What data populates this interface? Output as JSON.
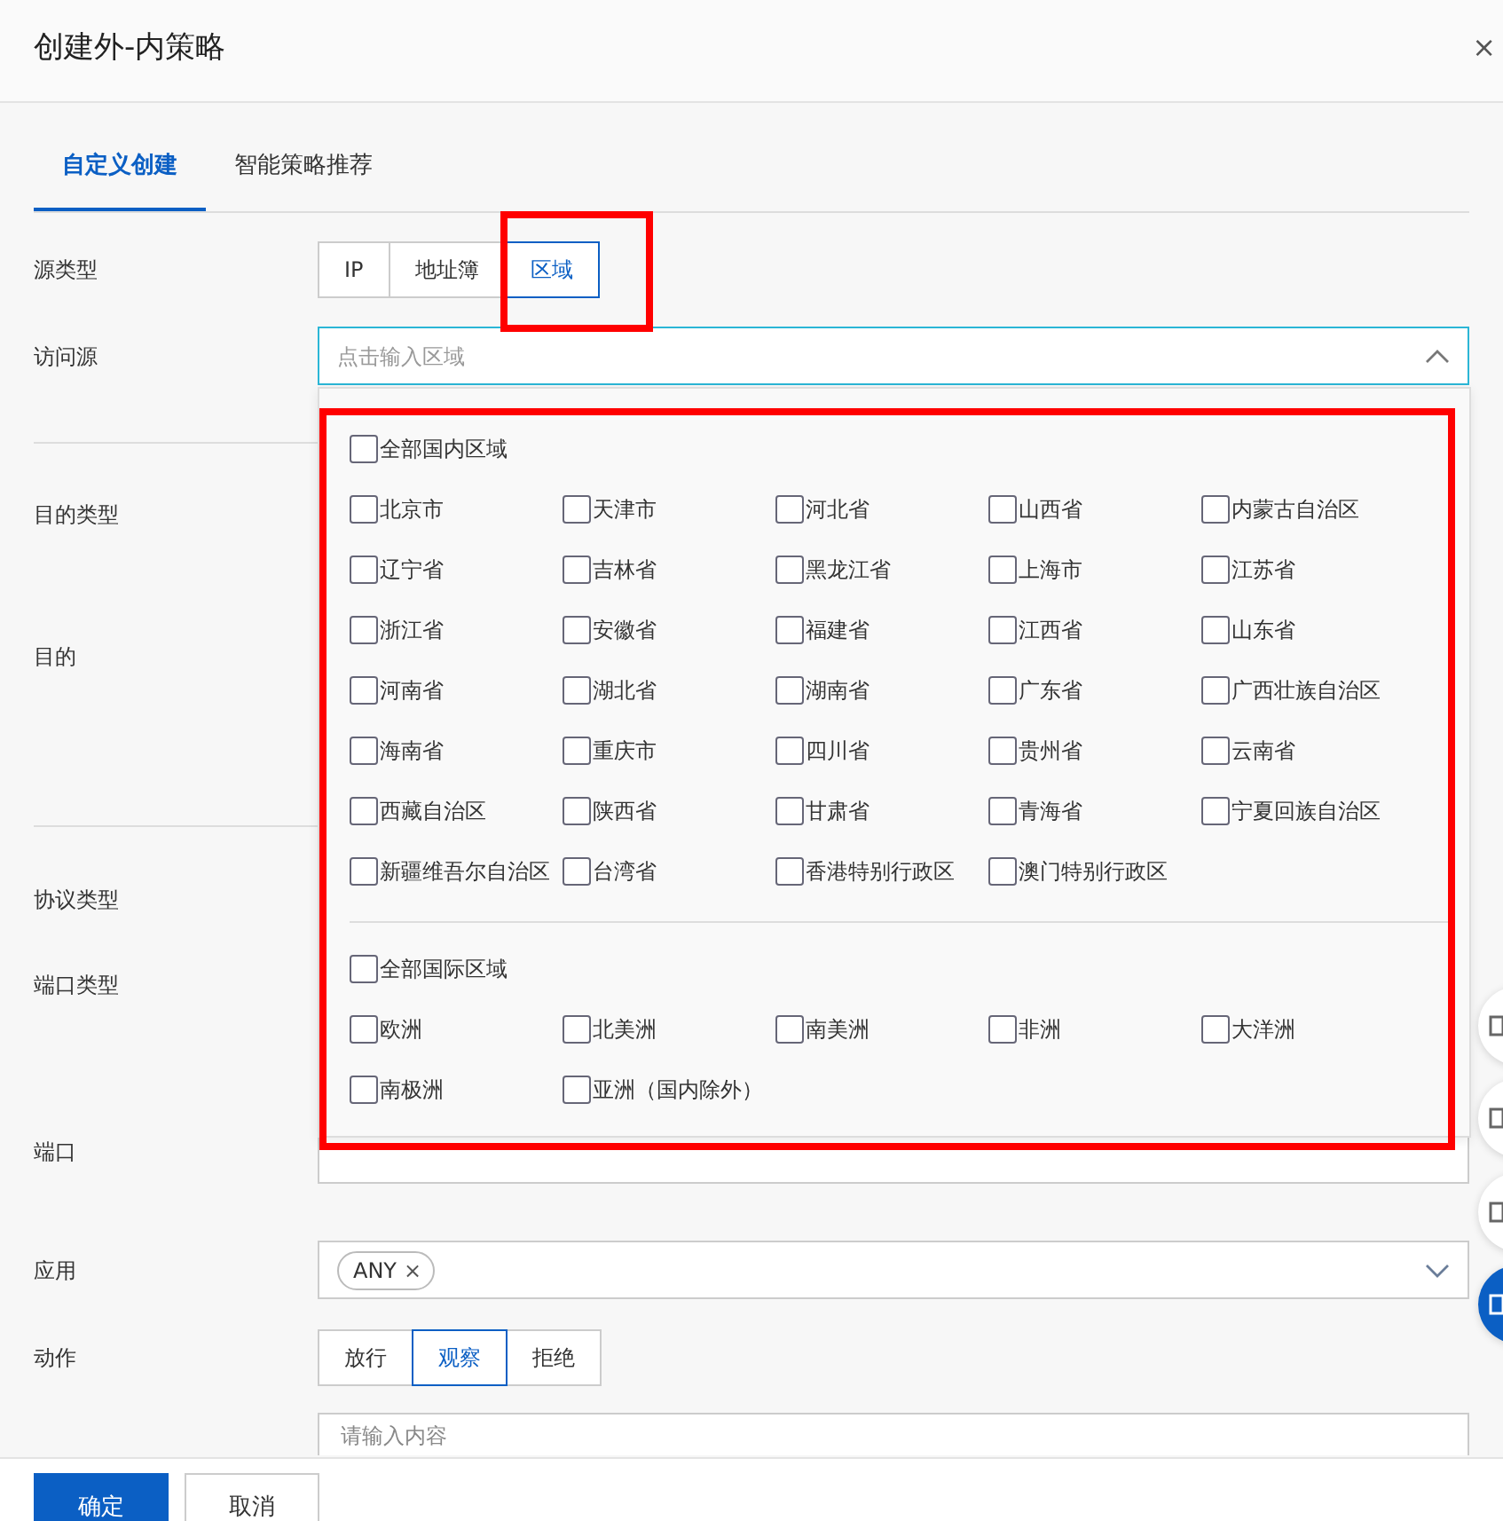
{
  "dialog": {
    "title": "创建外-内策略",
    "close": "×"
  },
  "tabs": [
    {
      "label": "自定义创建",
      "selected": true
    },
    {
      "label": "智能策略推荐",
      "selected": false
    }
  ],
  "fields": [
    {
      "kind": "segmented",
      "label": "源类型",
      "options": [
        {
          "label": "IP",
          "selected": false
        },
        {
          "label": "地址簿",
          "selected": false
        },
        {
          "label": "区域",
          "selected": true
        }
      ]
    },
    {
      "kind": "select",
      "label": "访问源",
      "placeholder": "点击输入区域",
      "expanded": true
    },
    {
      "kind": "divider"
    },
    {
      "kind": "label",
      "label": "目的类型"
    },
    {
      "kind": "label",
      "label": "目的"
    },
    {
      "kind": "divider"
    },
    {
      "kind": "label",
      "label": "协议类型"
    },
    {
      "kind": "label",
      "label": "端口类型"
    },
    {
      "kind": "input",
      "label": "端口"
    },
    {
      "kind": "tags",
      "label": "应用",
      "tags": [
        {
          "label": "ANY",
          "remove": "×"
        }
      ],
      "expanded": false
    },
    {
      "kind": "segmented",
      "label": "动作",
      "options": [
        {
          "label": "放行",
          "selected": false
        },
        {
          "label": "观察",
          "selected": true
        },
        {
          "label": "拒绝",
          "selected": false
        }
      ]
    },
    {
      "kind": "textarea",
      "placeholder": "请输入内容"
    }
  ],
  "region_dropdown": {
    "groups": [
      {
        "all": {
          "label": "全部国内区域",
          "checked": false
        },
        "regions": [
          {
            "label": "北京市",
            "checked": false
          },
          {
            "label": "天津市",
            "checked": false
          },
          {
            "label": "河北省",
            "checked": false
          },
          {
            "label": "山西省",
            "checked": false
          },
          {
            "label": "内蒙古自治区",
            "checked": false
          },
          {
            "label": "辽宁省",
            "checked": false
          },
          {
            "label": "吉林省",
            "checked": false
          },
          {
            "label": "黑龙江省",
            "checked": false
          },
          {
            "label": "上海市",
            "checked": false
          },
          {
            "label": "江苏省",
            "checked": false
          },
          {
            "label": "浙江省",
            "checked": false
          },
          {
            "label": "安徽省",
            "checked": false
          },
          {
            "label": "福建省",
            "checked": false
          },
          {
            "label": "江西省",
            "checked": false
          },
          {
            "label": "山东省",
            "checked": false
          },
          {
            "label": "河南省",
            "checked": false
          },
          {
            "label": "湖北省",
            "checked": false
          },
          {
            "label": "湖南省",
            "checked": false
          },
          {
            "label": "广东省",
            "checked": false
          },
          {
            "label": "广西壮族自治区",
            "checked": false
          },
          {
            "label": "海南省",
            "checked": false
          },
          {
            "label": "重庆市",
            "checked": false
          },
          {
            "label": "四川省",
            "checked": false
          },
          {
            "label": "贵州省",
            "checked": false
          },
          {
            "label": "云南省",
            "checked": false
          },
          {
            "label": "西藏自治区",
            "checked": false
          },
          {
            "label": "陕西省",
            "checked": false
          },
          {
            "label": "甘肃省",
            "checked": false
          },
          {
            "label": "青海省",
            "checked": false
          },
          {
            "label": "宁夏回族自治区",
            "checked": false
          },
          {
            "label": "新疆维吾尔自治区",
            "checked": false
          },
          {
            "label": "台湾省",
            "checked": false
          },
          {
            "label": "香港特别行政区",
            "checked": false
          },
          {
            "label": "澳门特别行政区",
            "checked": false
          }
        ]
      },
      {
        "all": {
          "label": "全部国际区域",
          "checked": false
        },
        "regions": [
          {
            "label": "欧洲",
            "checked": false
          },
          {
            "label": "北美洲",
            "checked": false
          },
          {
            "label": "南美洲",
            "checked": false
          },
          {
            "label": "非洲",
            "checked": false
          },
          {
            "label": "大洋洲",
            "checked": false
          },
          {
            "label": "南极洲",
            "checked": false
          },
          {
            "label": "亚洲（国内除外）",
            "checked": false
          }
        ]
      }
    ]
  },
  "annotations": [
    {
      "kind": "frame"
    },
    {
      "kind": "frame"
    }
  ],
  "footer": {
    "buttons": [
      {
        "label": "确定",
        "kind": "primary"
      },
      {
        "label": "取消",
        "kind": "secondary"
      }
    ]
  }
}
